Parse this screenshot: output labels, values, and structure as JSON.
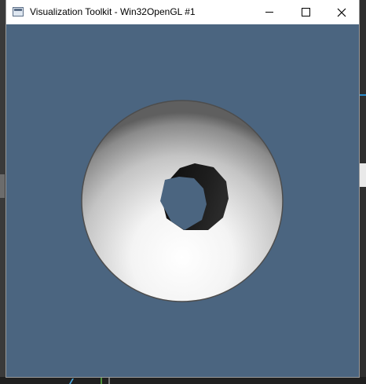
{
  "window": {
    "title": "Visualization Toolkit - Win32OpenGL #1",
    "icon": "app-window-icon",
    "controls": {
      "minimize_icon": "minimize-icon",
      "maximize_icon": "maximize-icon",
      "close_icon": "close-icon"
    }
  },
  "viewport": {
    "background_color": "#4b6580",
    "scene": "shaded sphere with dark hole"
  }
}
